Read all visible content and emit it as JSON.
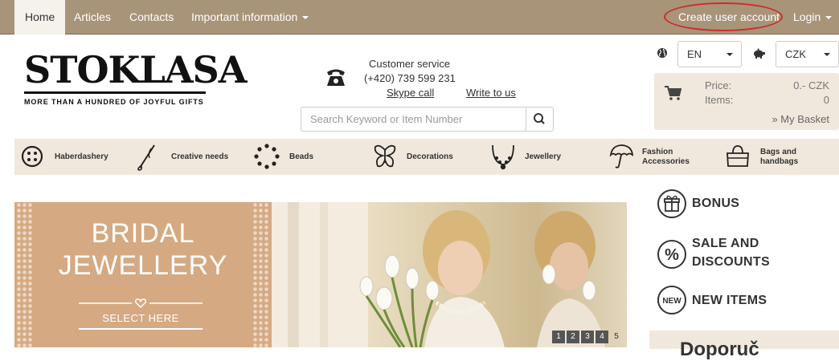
{
  "nav": {
    "home": "Home",
    "articles": "Articles",
    "contacts": "Contacts",
    "important": "Important information",
    "create_account": "Create user account",
    "login": "Login"
  },
  "logo": {
    "name": "STOKLASA",
    "tagline": "MORE THAN A HUNDRED OF JOYFUL GIFTS"
  },
  "customer_service": {
    "title": "Customer service",
    "phone": "(+420) 739 599 231",
    "skype": "Skype call",
    "write": "Write to us"
  },
  "search": {
    "placeholder": "Search Keyword or Item Number"
  },
  "language": {
    "value": "EN"
  },
  "currency": {
    "value": "CZK"
  },
  "basket": {
    "price_label": "Price:",
    "price_value": "0.- CZK",
    "items_label": "Items:",
    "items_value": "0",
    "link": "» My Basket"
  },
  "categories": [
    {
      "label": "Haberdashery",
      "icon": "button-icon"
    },
    {
      "label": "Creative needs",
      "icon": "needle-icon"
    },
    {
      "label": "Beads",
      "icon": "beads-icon"
    },
    {
      "label": "Decorations",
      "icon": "butterfly-icon"
    },
    {
      "label": "Jewellery",
      "icon": "necklace-icon"
    },
    {
      "label_1": "Fashion",
      "label_2": "Accessories",
      "icon": "umbrella-icon"
    },
    {
      "label_1": "Bags and",
      "label_2": "handbags",
      "icon": "bag-icon"
    }
  ],
  "banner": {
    "line1": "BRIDAL",
    "line2": "JEWELLERY",
    "cta": "SELECT HERE",
    "pages": [
      "1",
      "2",
      "3",
      "4",
      "5"
    ],
    "current_page": "5"
  },
  "promos": {
    "bonus": "BONUS",
    "sale_1": "SALE AND",
    "sale_2": "DISCOUNTS",
    "new": "NEW ITEMS",
    "new_badge": "NEW",
    "sale_badge": "%"
  },
  "bottom_box": {
    "text": "Doporuč"
  },
  "colors": {
    "nav_bg": "#a89479",
    "panel_bg": "#f0e8dc",
    "banner_left": "#d5a982",
    "highlight_oval": "#d12a2a"
  }
}
